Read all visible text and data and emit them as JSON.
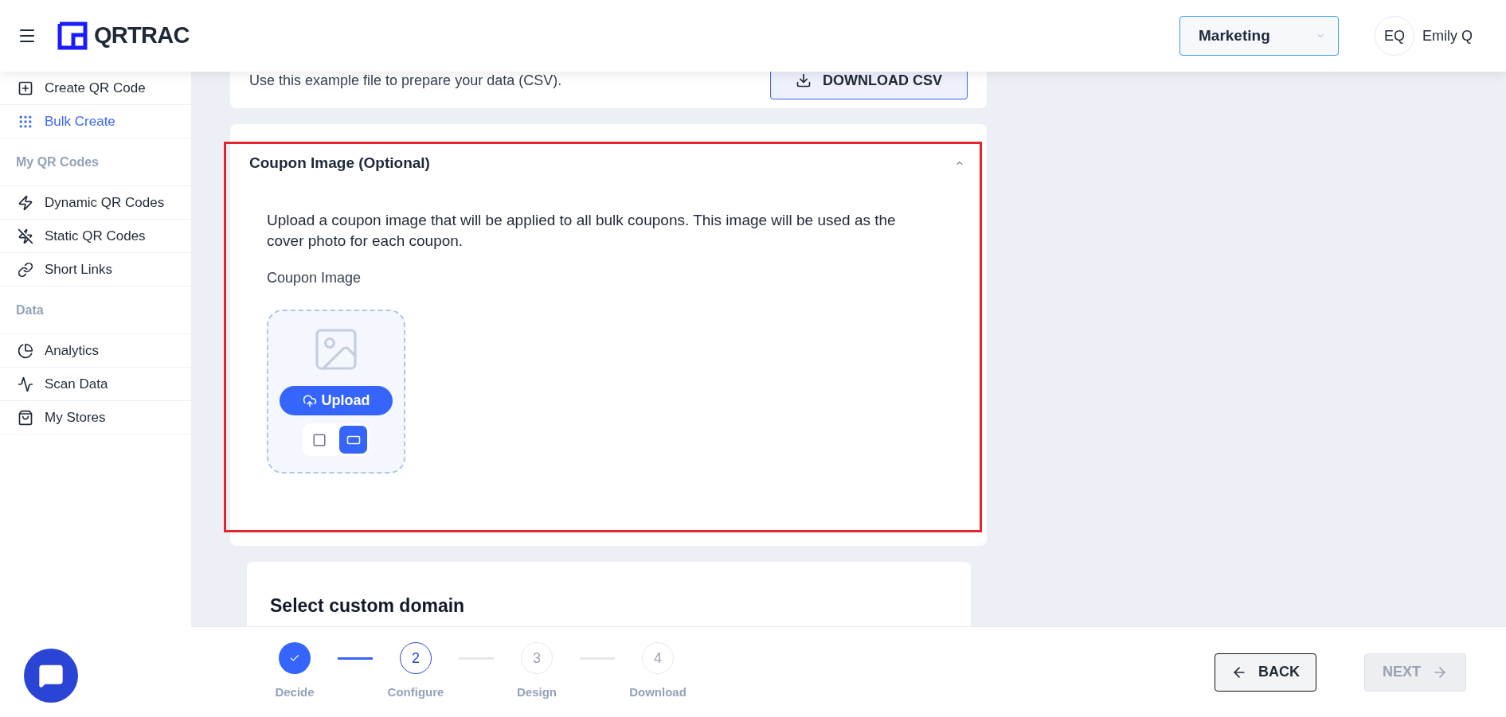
{
  "header": {
    "logo": "QRTRAC",
    "workspace": "Marketing",
    "user": {
      "initials": "EQ",
      "name": "Emily Q"
    }
  },
  "sidebar": {
    "items": [
      {
        "kind": "item",
        "label": "Create QR Code",
        "selected": false
      },
      {
        "kind": "item",
        "label": "Bulk Create",
        "selected": true
      },
      {
        "kind": "section",
        "label": "My QR Codes"
      },
      {
        "kind": "item",
        "label": "Dynamic QR Codes",
        "selected": false
      },
      {
        "kind": "item",
        "label": "Static QR Codes",
        "selected": false
      },
      {
        "kind": "item",
        "label": "Short Links",
        "selected": false
      },
      {
        "kind": "section",
        "label": "Data"
      },
      {
        "kind": "item",
        "label": "Analytics",
        "selected": false
      },
      {
        "kind": "item",
        "label": "Scan Data",
        "selected": false
      },
      {
        "kind": "item",
        "label": "My Stores",
        "selected": false
      }
    ]
  },
  "example_card": {
    "text": "Use this example file to prepare your data (CSV).",
    "button": "DOWNLOAD CSV"
  },
  "coupon_section": {
    "title": "Coupon Image (Optional)",
    "expanded": true,
    "description": "Upload a coupon image that will be applied to all bulk coupons. This image will be used as the cover photo for each coupon.",
    "field_label": "Coupon Image",
    "upload_button": "Upload",
    "shapes": [
      {
        "kind": "square",
        "selected": false
      },
      {
        "kind": "wide",
        "selected": true
      }
    ]
  },
  "domain_card": {
    "title": "Select custom domain"
  },
  "stepper": [
    {
      "label": "Decide",
      "kind": "done"
    },
    {
      "label": "Configure",
      "number": "2",
      "kind": "current"
    },
    {
      "label": "Design",
      "number": "3",
      "kind": "upcoming"
    },
    {
      "label": "Download",
      "number": "4",
      "kind": "upcoming"
    }
  ],
  "footer": {
    "back": "BACK",
    "next": "NEXT",
    "next_disabled": true
  }
}
